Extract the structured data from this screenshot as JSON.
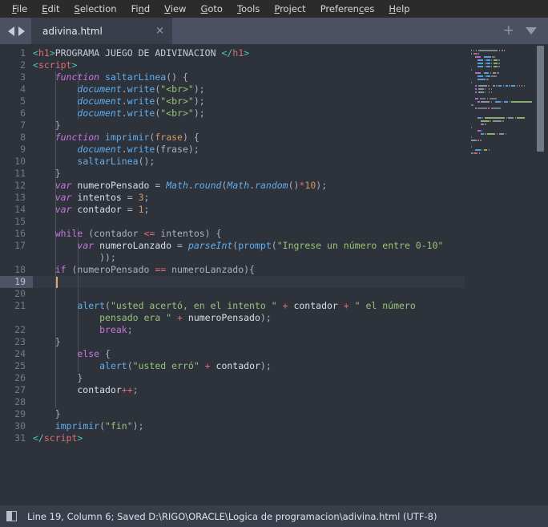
{
  "app": {
    "title": "adivina.html",
    "theme_bg": "#2d323b",
    "accent_cursor": "#f0a55e"
  },
  "menubar": {
    "items": [
      {
        "label": "File",
        "mnemonic": "F"
      },
      {
        "label": "Edit",
        "mnemonic": "E"
      },
      {
        "label": "Selection",
        "mnemonic": "S"
      },
      {
        "label": "Find",
        "mnemonic": "n"
      },
      {
        "label": "View",
        "mnemonic": "V"
      },
      {
        "label": "Goto",
        "mnemonic": "G"
      },
      {
        "label": "Tools",
        "mnemonic": "T"
      },
      {
        "label": "Project",
        "mnemonic": "P"
      },
      {
        "label": "Preferences",
        "mnemonic": "c"
      },
      {
        "label": "Help",
        "mnemonic": "H"
      }
    ]
  },
  "tabbar": {
    "back_icon": "arrow-left-icon",
    "forward_icon": "arrow-right-icon",
    "tabs": [
      {
        "label": "adivina.html",
        "close": "×",
        "active": true
      }
    ],
    "new_tab_icon": "+",
    "tab_menu_icon": "chevron-down-icon"
  },
  "editor": {
    "active_line": 19,
    "cursor_column": 6,
    "total_lines": 31,
    "lines": [
      {
        "n": 1,
        "tokens": [
          {
            "t": "<",
            "c": "tagbracket"
          },
          {
            "t": "h1",
            "c": "tagname"
          },
          {
            "t": ">",
            "c": "tagbracket"
          },
          {
            "t": "PROGRAMA JUEGO DE ADIVINACION ",
            "c": "plain"
          },
          {
            "t": "</",
            "c": "tagbracket"
          },
          {
            "t": "h1",
            "c": "tagname"
          },
          {
            "t": ">",
            "c": "tagbracket"
          }
        ]
      },
      {
        "n": 2,
        "tokens": [
          {
            "t": "<",
            "c": "tagbracket"
          },
          {
            "t": "script",
            "c": "tagname"
          },
          {
            "t": ">",
            "c": "tagbracket"
          }
        ]
      },
      {
        "n": 3,
        "tokens": [
          {
            "t": "    ",
            "c": "plain"
          },
          {
            "t": "function",
            "c": "keyword"
          },
          {
            "t": " ",
            "c": "plain"
          },
          {
            "t": "saltarLinea",
            "c": "func"
          },
          {
            "t": "() {",
            "c": "punc"
          }
        ]
      },
      {
        "n": 4,
        "tokens": [
          {
            "t": "        ",
            "c": "plain"
          },
          {
            "t": "document",
            "c": "obj"
          },
          {
            "t": ".",
            "c": "punc"
          },
          {
            "t": "write",
            "c": "func"
          },
          {
            "t": "(",
            "c": "punc"
          },
          {
            "t": "\"<br>\"",
            "c": "string"
          },
          {
            "t": ");",
            "c": "punc"
          }
        ]
      },
      {
        "n": 5,
        "tokens": [
          {
            "t": "        ",
            "c": "plain"
          },
          {
            "t": "document",
            "c": "obj"
          },
          {
            "t": ".",
            "c": "punc"
          },
          {
            "t": "write",
            "c": "func"
          },
          {
            "t": "(",
            "c": "punc"
          },
          {
            "t": "\"<br>\"",
            "c": "string"
          },
          {
            "t": ");",
            "c": "punc"
          }
        ]
      },
      {
        "n": 6,
        "tokens": [
          {
            "t": "        ",
            "c": "plain"
          },
          {
            "t": "document",
            "c": "obj"
          },
          {
            "t": ".",
            "c": "punc"
          },
          {
            "t": "write",
            "c": "func"
          },
          {
            "t": "(",
            "c": "punc"
          },
          {
            "t": "\"<br>\"",
            "c": "string"
          },
          {
            "t": ");",
            "c": "punc"
          }
        ]
      },
      {
        "n": 7,
        "tokens": [
          {
            "t": "    }",
            "c": "punc"
          }
        ]
      },
      {
        "n": 8,
        "tokens": [
          {
            "t": "    ",
            "c": "plain"
          },
          {
            "t": "function",
            "c": "keyword"
          },
          {
            "t": " ",
            "c": "plain"
          },
          {
            "t": "imprimir",
            "c": "func"
          },
          {
            "t": "(",
            "c": "punc"
          },
          {
            "t": "frase",
            "c": "param"
          },
          {
            "t": ") {",
            "c": "punc"
          }
        ]
      },
      {
        "n": 9,
        "tokens": [
          {
            "t": "        ",
            "c": "plain"
          },
          {
            "t": "document",
            "c": "obj"
          },
          {
            "t": ".",
            "c": "punc"
          },
          {
            "t": "write",
            "c": "func"
          },
          {
            "t": "(frase);",
            "c": "punc"
          }
        ]
      },
      {
        "n": 10,
        "tokens": [
          {
            "t": "        ",
            "c": "plain"
          },
          {
            "t": "saltarLinea",
            "c": "func"
          },
          {
            "t": "();",
            "c": "punc"
          }
        ]
      },
      {
        "n": 11,
        "tokens": [
          {
            "t": "    }",
            "c": "punc"
          }
        ]
      },
      {
        "n": 12,
        "tokens": [
          {
            "t": "    ",
            "c": "plain"
          },
          {
            "t": "var",
            "c": "keyword"
          },
          {
            "t": " numeroPensado ",
            "c": "var"
          },
          {
            "t": "=",
            "c": "punc"
          },
          {
            "t": " ",
            "c": "plain"
          },
          {
            "t": "Math",
            "c": "obj"
          },
          {
            "t": ".",
            "c": "punc"
          },
          {
            "t": "round",
            "c": "obj"
          },
          {
            "t": "(",
            "c": "punc"
          },
          {
            "t": "Math",
            "c": "obj"
          },
          {
            "t": ".",
            "c": "punc"
          },
          {
            "t": "random",
            "c": "obj"
          },
          {
            "t": "()",
            "c": "punc"
          },
          {
            "t": "*",
            "c": "op"
          },
          {
            "t": "10",
            "c": "num"
          },
          {
            "t": ");",
            "c": "punc"
          }
        ]
      },
      {
        "n": 13,
        "tokens": [
          {
            "t": "    ",
            "c": "plain"
          },
          {
            "t": "var",
            "c": "keyword"
          },
          {
            "t": " intentos ",
            "c": "var"
          },
          {
            "t": "=",
            "c": "punc"
          },
          {
            "t": " ",
            "c": "plain"
          },
          {
            "t": "3",
            "c": "num"
          },
          {
            "t": ";",
            "c": "punc"
          }
        ]
      },
      {
        "n": 14,
        "tokens": [
          {
            "t": "    ",
            "c": "plain"
          },
          {
            "t": "var",
            "c": "keyword"
          },
          {
            "t": " contador ",
            "c": "var"
          },
          {
            "t": "=",
            "c": "punc"
          },
          {
            "t": " ",
            "c": "plain"
          },
          {
            "t": "1",
            "c": "num"
          },
          {
            "t": ";",
            "c": "punc"
          }
        ]
      },
      {
        "n": 15,
        "tokens": []
      },
      {
        "n": 16,
        "tokens": [
          {
            "t": "    ",
            "c": "plain"
          },
          {
            "t": "while",
            "c": "ctrl"
          },
          {
            "t": " (contador ",
            "c": "punc"
          },
          {
            "t": "<=",
            "c": "op"
          },
          {
            "t": " intentos) {",
            "c": "punc"
          }
        ]
      },
      {
        "n": 17,
        "tokens": [
          {
            "t": "        ",
            "c": "plain"
          },
          {
            "t": "var",
            "c": "keyword"
          },
          {
            "t": " numeroLanzado ",
            "c": "var"
          },
          {
            "t": "=",
            "c": "punc"
          },
          {
            "t": " ",
            "c": "plain"
          },
          {
            "t": "parseInt",
            "c": "funcdecl"
          },
          {
            "t": "(",
            "c": "punc"
          },
          {
            "t": "prompt",
            "c": "func"
          },
          {
            "t": "(",
            "c": "punc"
          },
          {
            "t": "\"Ingrese un número entre 0-10\"",
            "c": "string"
          }
        ],
        "wrap": [
          {
            "t": "            ));",
            "c": "punc"
          }
        ]
      },
      {
        "n": 18,
        "tokens": [
          {
            "t": "    ",
            "c": "plain"
          },
          {
            "t": "if",
            "c": "ctrl"
          },
          {
            "t": " (numeroPensado ",
            "c": "punc"
          },
          {
            "t": "==",
            "c": "op"
          },
          {
            "t": " numeroLanzado){",
            "c": "punc"
          }
        ]
      },
      {
        "n": 19,
        "tokens": []
      },
      {
        "n": 20,
        "tokens": []
      },
      {
        "n": 21,
        "tokens": [
          {
            "t": "        ",
            "c": "plain"
          },
          {
            "t": "alert",
            "c": "func"
          },
          {
            "t": "(",
            "c": "punc"
          },
          {
            "t": "\"usted acertó, en el intento \"",
            "c": "string"
          },
          {
            "t": " + ",
            "c": "op"
          },
          {
            "t": "contador",
            "c": "var"
          },
          {
            "t": " + ",
            "c": "op"
          },
          {
            "t": "\" el número",
            "c": "string"
          }
        ],
        "wrap": [
          {
            "t": "            ",
            "c": "plain"
          },
          {
            "t": "pensado era \"",
            "c": "string"
          },
          {
            "t": " + ",
            "c": "op"
          },
          {
            "t": "numeroPensado",
            "c": "var"
          },
          {
            "t": ");",
            "c": "punc"
          }
        ]
      },
      {
        "n": 22,
        "tokens": [
          {
            "t": "            ",
            "c": "plain"
          },
          {
            "t": "break",
            "c": "ctrl"
          },
          {
            "t": ";",
            "c": "punc"
          }
        ]
      },
      {
        "n": 23,
        "tokens": [
          {
            "t": "    }",
            "c": "punc"
          }
        ]
      },
      {
        "n": 24,
        "tokens": [
          {
            "t": "        ",
            "c": "plain"
          },
          {
            "t": "else",
            "c": "ctrl"
          },
          {
            "t": " {",
            "c": "punc"
          }
        ]
      },
      {
        "n": 25,
        "tokens": [
          {
            "t": "            ",
            "c": "plain"
          },
          {
            "t": "alert",
            "c": "func"
          },
          {
            "t": "(",
            "c": "punc"
          },
          {
            "t": "\"usted erró\"",
            "c": "string"
          },
          {
            "t": " + ",
            "c": "op"
          },
          {
            "t": "contador",
            "c": "var"
          },
          {
            "t": ");",
            "c": "punc"
          }
        ]
      },
      {
        "n": 26,
        "tokens": [
          {
            "t": "        }",
            "c": "punc"
          }
        ]
      },
      {
        "n": 27,
        "tokens": [
          {
            "t": "        contador",
            "c": "var"
          },
          {
            "t": "++",
            "c": "op"
          },
          {
            "t": ";",
            "c": "punc"
          }
        ]
      },
      {
        "n": 28,
        "tokens": []
      },
      {
        "n": 29,
        "tokens": [
          {
            "t": "    }",
            "c": "punc"
          }
        ]
      },
      {
        "n": 30,
        "tokens": [
          {
            "t": "    ",
            "c": "plain"
          },
          {
            "t": "imprimir",
            "c": "func"
          },
          {
            "t": "(",
            "c": "punc"
          },
          {
            "t": "\"fin\"",
            "c": "string"
          },
          {
            "t": ");",
            "c": "punc"
          }
        ]
      },
      {
        "n": 31,
        "tokens": [
          {
            "t": "</",
            "c": "tagbracket"
          },
          {
            "t": "script",
            "c": "tagname"
          },
          {
            "t": ">",
            "c": "tagbracket"
          }
        ]
      }
    ]
  },
  "minimap": {
    "scrollbar_label": "vertical-scrollbar"
  },
  "statusbar": {
    "icon": "panel-toggle-icon",
    "text": "Line 19, Column 6; Saved D:\\RIGO\\ORACLE\\Logica de programacion\\adivina.html (UTF-8)"
  }
}
